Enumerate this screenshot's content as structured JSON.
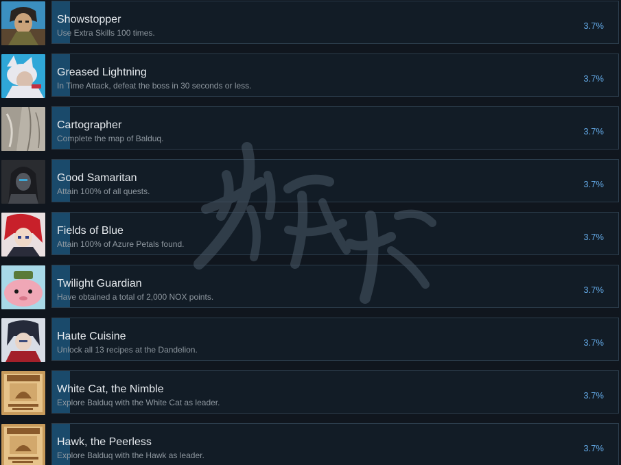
{
  "achievements": [
    {
      "title": "Showstopper",
      "description": "Use Extra Skills 100 times.",
      "percent": "3.7%",
      "icon": "swordsman-portrait-icon",
      "icon_colors": [
        "#3b8fc0",
        "#5a4630",
        "#c9a27a"
      ]
    },
    {
      "title": "Greased Lightning",
      "description": "In Time Attack, defeat the boss in 30 seconds or less.",
      "percent": "3.7%",
      "icon": "white-cat-girl-portrait-icon",
      "icon_colors": [
        "#2fa7d8",
        "#e8e8ee",
        "#d9bfae"
      ]
    },
    {
      "title": "Cartographer",
      "description": "Complete the map of Balduq.",
      "percent": "3.7%",
      "icon": "old-map-icon",
      "icon_colors": [
        "#b9b3a8",
        "#7d776d",
        "#dcd7ce"
      ]
    },
    {
      "title": "Good Samaritan",
      "description": "Attain 100% of all quests.",
      "percent": "3.7%",
      "icon": "hooded-figure-portrait-icon",
      "icon_colors": [
        "#1b1c20",
        "#53575e",
        "#3fa8d6"
      ]
    },
    {
      "title": "Fields of Blue",
      "description": "Attain 100% of Azure Petals found.",
      "percent": "3.7%",
      "icon": "red-haired-girl-portrait-icon",
      "icon_colors": [
        "#c8202a",
        "#2a2c3a",
        "#f0d9c8"
      ]
    },
    {
      "title": "Twilight Guardian",
      "description": "Have obtained a total of 2,000 NOX points.",
      "percent": "3.7%",
      "icon": "pink-creature-icon",
      "icon_colors": [
        "#f0a7b6",
        "#5a7a3a",
        "#a8d9e8"
      ]
    },
    {
      "title": "Haute Cuisine",
      "description": "Unlock all 13 recipes at the Dandelion.",
      "percent": "3.7%",
      "icon": "dark-haired-boy-portrait-icon",
      "icon_colors": [
        "#252a3a",
        "#a3202a",
        "#e9d4c6"
      ]
    },
    {
      "title": "White Cat, the Nimble",
      "description": "Explore Balduq with the White Cat as leader.",
      "percent": "3.7%",
      "icon": "wanted-poster-icon",
      "icon_colors": [
        "#c79a5b",
        "#8a5a2b",
        "#e6c38a"
      ]
    },
    {
      "title": "Hawk, the Peerless",
      "description": "Explore Balduq with the Hawk as leader.",
      "percent": "3.7%",
      "icon": "wanted-poster-icon",
      "icon_colors": [
        "#c79a5b",
        "#8a5a2b",
        "#e6c38a"
      ]
    }
  ],
  "colors": {
    "background": "#10161e",
    "card": "#121c26",
    "card_border": "#2c3d4c",
    "progress_bar": "#1a4a6b",
    "title": "#e6eaee",
    "description": "#8f98a0",
    "percent": "#62a7e3"
  }
}
